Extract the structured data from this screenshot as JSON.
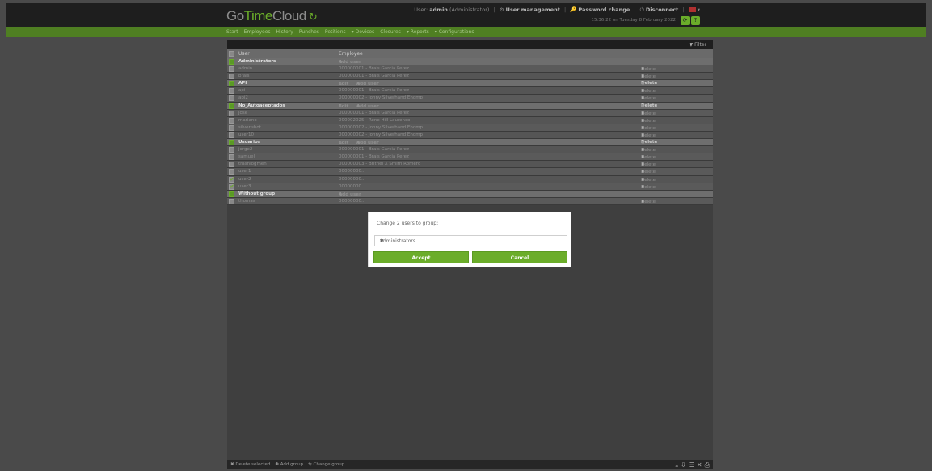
{
  "header": {
    "logo_go": "Go",
    "logo_time": "Time",
    "logo_cloud": "Cloud",
    "user_label": "User:",
    "user_name": "admin",
    "user_role": "(Administrator)",
    "user_management": "User management",
    "password_change": "Password change",
    "disconnect": "Disconnect",
    "datetime": "15:36:22 on Tuesday 8 February 2022"
  },
  "nav": [
    "Start",
    "Employees",
    "History",
    "Punches",
    "Petitions",
    "▾ Devices",
    "Closures",
    "▾ Reports",
    "▾ Configurations"
  ],
  "table": {
    "filter_label": "Filter",
    "col_user": "User",
    "col_employee": "Employee",
    "rows": [
      {
        "type": "group",
        "name": "Administrators",
        "edit": "",
        "add": "Add user",
        "delete": ""
      },
      {
        "type": "user",
        "name": "admin",
        "employee": "000000001 - Brais Garcia Perez",
        "delete": "Delete",
        "checked": false
      },
      {
        "type": "user",
        "name": "brais",
        "employee": "000000001 - Brais Garcia Perez",
        "delete": "Delete",
        "checked": false
      },
      {
        "type": "group",
        "name": "API",
        "edit": "Edit",
        "add": "Add user",
        "delete": "Delete"
      },
      {
        "type": "user",
        "name": "api",
        "employee": "000000001 - Brais Garcia Perez",
        "delete": "Delete",
        "checked": false
      },
      {
        "type": "user",
        "name": "api2",
        "employee": "000000002 - Johny Silverhand Ehomp",
        "delete": "Delete",
        "checked": false
      },
      {
        "type": "group",
        "name": "No_Autoaceptados",
        "edit": "Edit",
        "add": "Add user",
        "delete": "Delete"
      },
      {
        "type": "user",
        "name": "jose",
        "employee": "000000001 - Brais Garcia Perez",
        "delete": "Delete",
        "checked": false
      },
      {
        "type": "user",
        "name": "mariano",
        "employee": "000002025 - Rene Hill Laurenco",
        "delete": "Delete",
        "checked": false
      },
      {
        "type": "user",
        "name": "silver.shot",
        "employee": "000000002 - Johny Silverhand Ehomp",
        "delete": "Delete",
        "checked": false
      },
      {
        "type": "user",
        "name": "user10",
        "employee": "000000002 - Johny Silverhand Ehomp",
        "delete": "Delete",
        "checked": false
      },
      {
        "type": "group",
        "name": "Usuarios",
        "edit": "Edit",
        "add": "Add user",
        "delete": "Delete"
      },
      {
        "type": "user",
        "name": "jorge2",
        "employee": "000000001 - Brais Garcia Perez",
        "delete": "Delete",
        "checked": false
      },
      {
        "type": "user",
        "name": "samuel",
        "employee": "000000001 - Brais Garcia Perez",
        "delete": "Delete",
        "checked": false
      },
      {
        "type": "user",
        "name": "trashlogmen",
        "employee": "000000003 - Brithel X Smith Romero",
        "delete": "Delete",
        "checked": false
      },
      {
        "type": "user",
        "name": "user1",
        "employee": "00000000...",
        "delete": "Delete",
        "checked": false
      },
      {
        "type": "user",
        "name": "user2",
        "employee": "00000000...",
        "delete": "Delete",
        "checked": true
      },
      {
        "type": "user",
        "name": "user3",
        "employee": "00000000...",
        "delete": "Delete",
        "checked": true
      },
      {
        "type": "group",
        "name": "Without group",
        "edit": "",
        "add": "Add user",
        "delete": ""
      },
      {
        "type": "user",
        "name": "thomas",
        "employee": "00000000...",
        "delete": "Delete",
        "checked": false
      }
    ]
  },
  "footer": {
    "delete_selected": "Delete selected",
    "add_group": "Add group",
    "change_group": "Change group"
  },
  "modal": {
    "title": "Change 2 users to group:",
    "selected_group": "Administrators",
    "accept": "Accept",
    "cancel": "Cancel"
  }
}
